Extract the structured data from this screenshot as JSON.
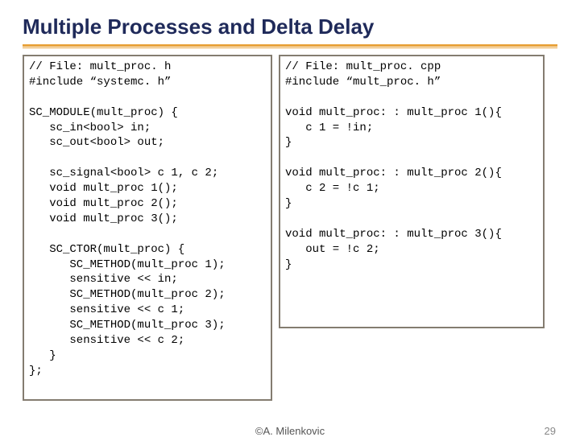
{
  "title": "Multiple Processes and Delta Delay",
  "code_left": "// File: mult_proc. h\n#include “systemc. h”\n\nSC_MODULE(mult_proc) {\n   sc_in<bool> in;\n   sc_out<bool> out;\n\n   sc_signal<bool> c 1, c 2;\n   void mult_proc 1();\n   void mult_proc 2();\n   void mult_proc 3();\n\n   SC_CTOR(mult_proc) {\n      SC_METHOD(mult_proc 1);\n      sensitive << in;\n      SC_METHOD(mult_proc 2);\n      sensitive << c 1;\n      SC_METHOD(mult_proc 3);\n      sensitive << c 2;\n   }\n};",
  "code_right": "// File: mult_proc. cpp\n#include “mult_proc. h”\n\nvoid mult_proc: : mult_proc 1(){\n   c 1 = !in;\n}\n\nvoid mult_proc: : mult_proc 2(){\n   c 2 = !c 1;\n}\n\nvoid mult_proc: : mult_proc 3(){\n   out = !c 2;\n}",
  "footer": {
    "copyright": "©A. Milenkovic",
    "page": "29"
  }
}
